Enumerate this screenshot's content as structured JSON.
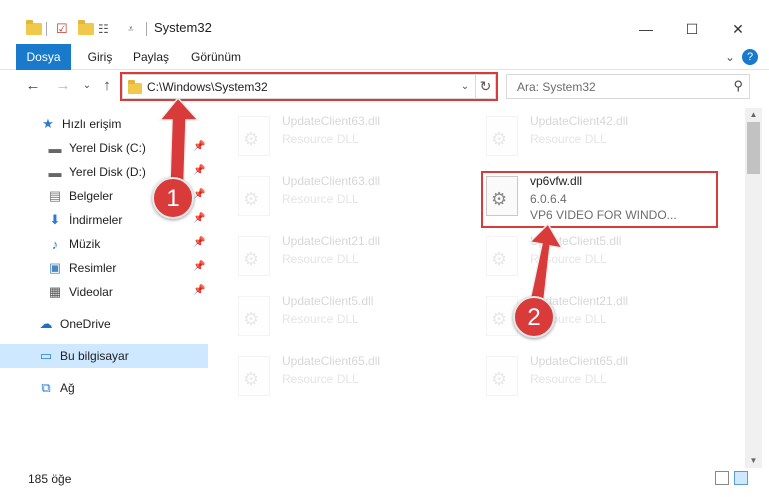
{
  "window": {
    "title": "System32",
    "minimize": "—",
    "maximize": "☐",
    "close": "✕"
  },
  "ribbon": {
    "tabs": [
      "Dosya",
      "Giriş",
      "Paylaş",
      "Görünüm"
    ],
    "expand": "⌄",
    "help": "?"
  },
  "nav": {
    "back": "←",
    "forward": "→",
    "recent": "⌄",
    "up": "↑"
  },
  "address": {
    "path": "C:\\Windows\\System32",
    "dropdown": "⌄",
    "refresh": "↻"
  },
  "search": {
    "placeholder": "Ara: System32",
    "icon": "search-icon"
  },
  "sidebar": {
    "items": [
      {
        "label": "Hızlı erişim",
        "icon": "star-icon",
        "pinned": false
      },
      {
        "label": "Yerel Disk (C:)",
        "icon": "drive-icon",
        "pinned": true
      },
      {
        "label": "Yerel Disk (D:)",
        "icon": "drive-icon",
        "pinned": true
      },
      {
        "label": "Belgeler",
        "icon": "document-icon",
        "pinned": true
      },
      {
        "label": "İndirmeler",
        "icon": "download-icon",
        "pinned": true
      },
      {
        "label": "Müzik",
        "icon": "music-icon",
        "pinned": true
      },
      {
        "label": "Resimler",
        "icon": "pictures-icon",
        "pinned": true
      },
      {
        "label": "Videolar",
        "icon": "video-icon",
        "pinned": true
      },
      {
        "label": "OneDrive",
        "icon": "cloud-icon",
        "pinned": false
      },
      {
        "label": "Bu bilgisayar",
        "icon": "computer-icon",
        "pinned": false,
        "selected": true
      },
      {
        "label": "Ağ",
        "icon": "network-icon",
        "pinned": false
      }
    ]
  },
  "files": [
    {
      "name": "UpdateClient63.dll",
      "line1": "Resource DLL",
      "line2": ""
    },
    {
      "name": "UpdateClient42.dll",
      "line1": "Resource DLL",
      "line2": ""
    },
    {
      "name": "UpdateClient63.dll",
      "line1": "Resource DLL",
      "line2": ""
    },
    {
      "name": "vp6vfw.dll",
      "line1": "6.0.6.4",
      "line2": "VP6 VIDEO FOR WINDO..."
    },
    {
      "name": "UpdateClient21.dll",
      "line1": "Resource DLL",
      "line2": ""
    },
    {
      "name": "UpdateClient5.dll",
      "line1": "Resource DLL",
      "line2": ""
    },
    {
      "name": "UpdateClient5.dll",
      "line1": "Resource DLL",
      "line2": ""
    },
    {
      "name": "UpdateClient21.dll",
      "line1": "Resource DLL",
      "line2": ""
    },
    {
      "name": "UpdateClient65.dll",
      "line1": "Resource DLL",
      "line2": ""
    },
    {
      "name": "UpdateClient65.dll",
      "line1": "Resource DLL",
      "line2": ""
    }
  ],
  "status": {
    "count": "185 öğe"
  },
  "annotations": {
    "marker1": "1",
    "marker2": "2",
    "color": "#d93b3b"
  }
}
